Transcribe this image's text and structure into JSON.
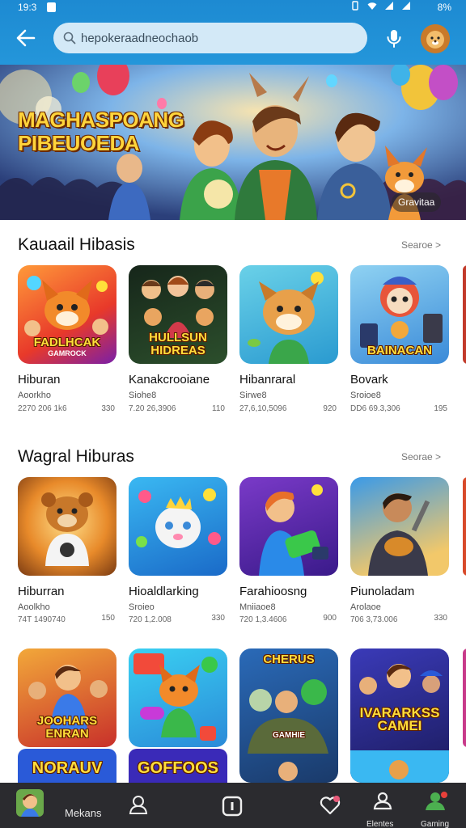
{
  "status_bar": {
    "time": "19:3",
    "battery": "8%"
  },
  "search": {
    "query": "hepokeraadneochaob"
  },
  "banner": {
    "title": "MAGHASPOANG PIBEUOEDA",
    "badge": "Gravitaa"
  },
  "sections": [
    {
      "title": "Kauaail Hibasis",
      "see_all": "Searoe >",
      "apps": [
        {
          "name": "Hiburan",
          "developer": "Aoorkho",
          "meta": "2270 206 1k6",
          "size": "330",
          "caption": "FADLHCAK",
          "caption_sub": "GAMROCK"
        },
        {
          "name": "Kanakcrooiane",
          "developer": "Siohe8",
          "meta": "7.20 26,3906",
          "size": "110",
          "caption": "HULLSUN HIDREAS",
          "caption_sub": ""
        },
        {
          "name": "Hibanraral",
          "developer": "Sirwe8",
          "meta": "27,6,10,5096",
          "size": "920",
          "caption": "",
          "caption_sub": ""
        },
        {
          "name": "Bovark",
          "developer": "Sroioe8",
          "meta": "DD6 69.3,306",
          "size": "195",
          "caption": "BAINACAN",
          "caption_sub": ""
        }
      ]
    },
    {
      "title": "Wagral Hiburas",
      "see_all": "Seorae >",
      "apps": [
        {
          "name": "Hiburran",
          "developer": "Aoolkho",
          "meta": "74T 1490740",
          "size": "150",
          "caption": "",
          "caption_sub": ""
        },
        {
          "name": "Hioaldlarking",
          "developer": "Sroieo",
          "meta": "720 1,2.008",
          "size": "330",
          "caption": "",
          "caption_sub": ""
        },
        {
          "name": "Farahioosng",
          "developer": "Mniiaoe8",
          "meta": "720 1,3.4606",
          "size": "900",
          "caption": "",
          "caption_sub": ""
        },
        {
          "name": "Piunoladam",
          "developer": "Arolaoe",
          "meta": "706 3,73.006",
          "size": "330",
          "caption": "",
          "caption_sub": ""
        }
      ]
    },
    {
      "title": "",
      "apps": [
        {
          "caption": "JOOHARS ENRAN",
          "caption_sub": "",
          "bottom": "NORAUV"
        },
        {
          "caption": "",
          "caption_sub": "",
          "bottom": "GOFFOOS"
        },
        {
          "caption": "CHERUS",
          "caption_sub": "GAMHIE",
          "bottom": ""
        },
        {
          "caption": "IVARARKSS CAMEI",
          "caption_sub": "",
          "bottom": ""
        }
      ]
    }
  ],
  "bottom_nav": {
    "label": "Mekans",
    "items": [
      {
        "label": "Elentes"
      },
      {
        "label": "Gaming"
      }
    ]
  },
  "colors": {
    "app_bar": "#1d8ad2",
    "search_bg": "#d3e9f7",
    "nav_bg": "#2b2b2f",
    "caption": "#ffde3b",
    "gaming_icon": "#4caf50"
  },
  "icons": [
    "back-arrow",
    "search",
    "microphone",
    "user",
    "home-square",
    "heart",
    "people-group"
  ]
}
